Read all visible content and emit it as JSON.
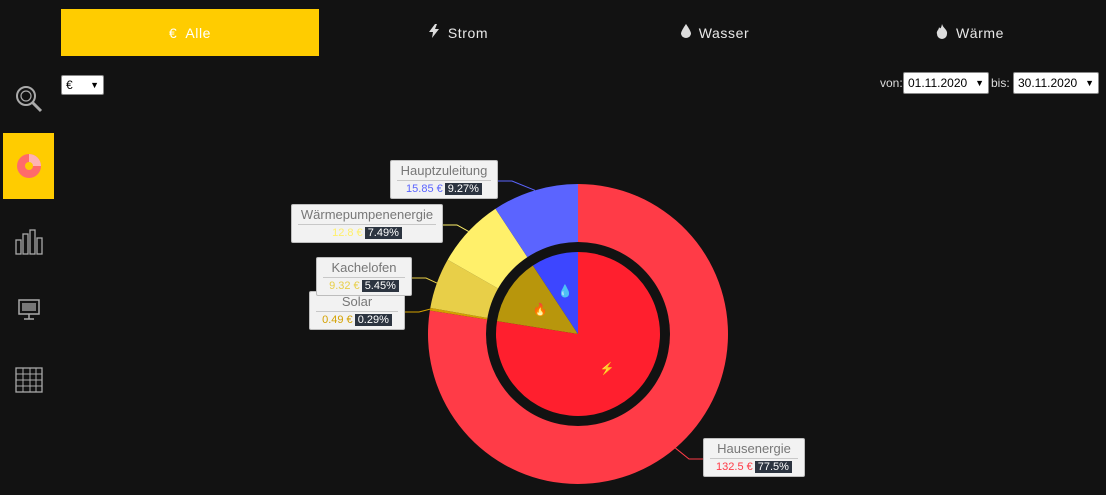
{
  "tabs": [
    {
      "id": "alle",
      "icon": "€",
      "label": "Alle",
      "active": true
    },
    {
      "id": "strom",
      "icon": "⚡",
      "label": "Strom",
      "active": false
    },
    {
      "id": "wasser",
      "icon": "💧",
      "label": "Wasser",
      "active": false
    },
    {
      "id": "waerme",
      "icon": "🔥",
      "label": "Wärme",
      "active": false
    }
  ],
  "sidebar": {
    "items": [
      {
        "name": "search-analysis",
        "icon": "magnifier-icon",
        "active": false
      },
      {
        "name": "pie-chart",
        "icon": "pie-chart-icon",
        "active": true
      },
      {
        "name": "bar-chart",
        "icon": "bar-chart-icon",
        "active": false
      },
      {
        "name": "monitor",
        "icon": "monitor-icon",
        "active": false
      },
      {
        "name": "table",
        "icon": "table-icon",
        "active": false
      }
    ]
  },
  "unit_select": {
    "value": "€"
  },
  "date_range": {
    "from_label": "von:",
    "from_value": "01.11.2020",
    "to_label": "bis:",
    "to_value": "30.11.2020"
  },
  "colors": {
    "accent": "#ffcc00",
    "background": "#121212"
  },
  "chart_data": {
    "type": "pie",
    "currency": "€",
    "outer_series": [
      {
        "name": "Hausenergie",
        "value": 132.5,
        "value_label": "132.5 €",
        "percent": "77.5%",
        "color": "#ff3b47"
      },
      {
        "name": "Solar",
        "value": 0.49,
        "value_label": "0.49 €",
        "percent": "0.29%",
        "color": "#d4a100"
      },
      {
        "name": "Kachelofen",
        "value": 9.32,
        "value_label": "9.32 €",
        "percent": "5.45%",
        "color": "#e8cf48"
      },
      {
        "name": "Wärmepumpenenergie",
        "value": 12.8,
        "value_label": "12.8 €",
        "percent": "7.49%",
        "color": "#fff06a"
      },
      {
        "name": "Hauptzuleitung",
        "value": 15.85,
        "value_label": "15.85 €",
        "percent": "9.27%",
        "color": "#5b64ff"
      }
    ],
    "inner_series": [
      {
        "name": "Strom",
        "icon": "⚡",
        "value": 132.5,
        "color": "#ff1f2e"
      },
      {
        "name": "Wärme",
        "icon": "🔥",
        "value": 22.61,
        "color": "#b8960c"
      },
      {
        "name": "Wasser",
        "icon": "💧",
        "value": 15.85,
        "color": "#3d46ff"
      }
    ]
  }
}
